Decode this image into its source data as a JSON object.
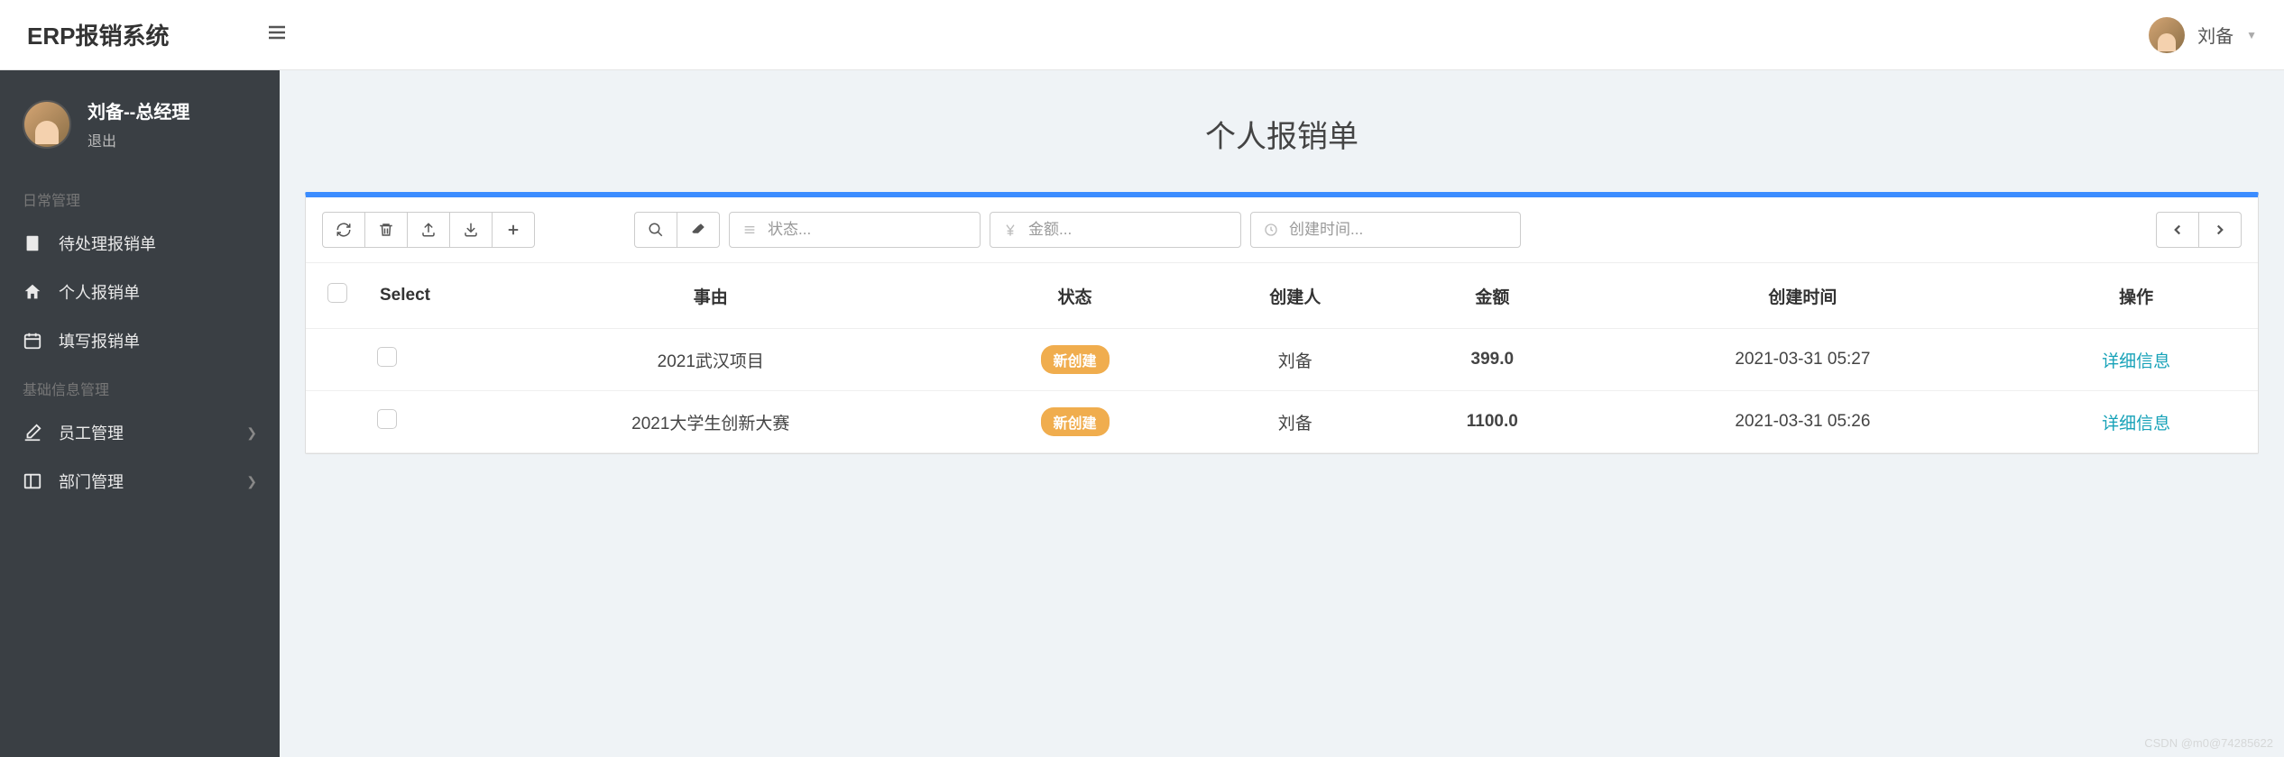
{
  "header": {
    "app_title": "ERP报销系统",
    "username": "刘备"
  },
  "sidebar": {
    "user_title": "刘备--总经理",
    "logout_label": "退出",
    "sections": [
      {
        "label": "日常管理",
        "items": [
          {
            "icon": "file",
            "label": "待处理报销单",
            "expandable": false
          },
          {
            "icon": "home",
            "label": "个人报销单",
            "expandable": false
          },
          {
            "icon": "calendar",
            "label": "填写报销单",
            "expandable": false
          }
        ]
      },
      {
        "label": "基础信息管理",
        "items": [
          {
            "icon": "edit",
            "label": "员工管理",
            "expandable": true
          },
          {
            "icon": "columns",
            "label": "部门管理",
            "expandable": true
          }
        ]
      }
    ]
  },
  "page": {
    "title": "个人报销单"
  },
  "filters": {
    "status_placeholder": "状态...",
    "amount_placeholder": "金额...",
    "time_placeholder": "创建时间..."
  },
  "table": {
    "headers": [
      "Select",
      "事由",
      "状态",
      "创建人",
      "金额",
      "创建时间",
      "操作"
    ],
    "rows": [
      {
        "reason": "2021武汉项目",
        "status": "新创建",
        "creator": "刘备",
        "amount": "399.0",
        "created_at": "2021-03-31 05:27",
        "action": "详细信息"
      },
      {
        "reason": "2021大学生创新大赛",
        "status": "新创建",
        "creator": "刘备",
        "amount": "1100.0",
        "created_at": "2021-03-31 05:26",
        "action": "详细信息"
      }
    ]
  },
  "watermark": "CSDN @m0@74285622"
}
